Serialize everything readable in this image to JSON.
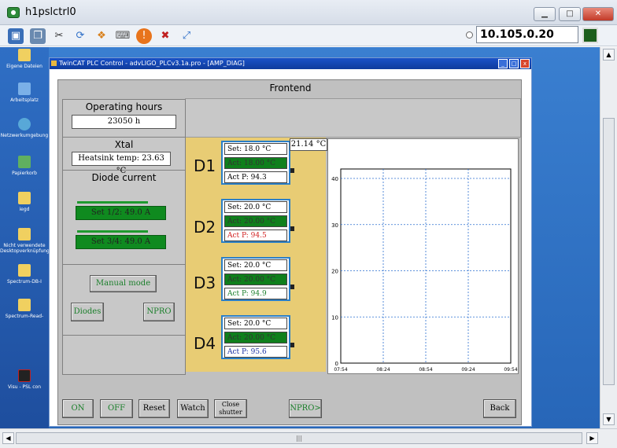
{
  "window": {
    "title": "h1pslctrl0",
    "address": "10.105.0.20"
  },
  "desktop": {
    "icons": [
      "Eigene Dateien",
      "Arbeitsplatz",
      "Netzwerkumgebung",
      "Papierkorb",
      "iegd",
      "Nicht verwendete Desktopverknüpfungen",
      "Spectrum-DB-I",
      "Spectrum-Read-",
      "Visu - PSL con"
    ]
  },
  "twincat": {
    "title": "TwinCAT PLC Control - advLIGO_PLCv3.1a.pro - [AMP_DIAG]"
  },
  "panel": {
    "heading": "Frontend",
    "operating_hours": {
      "label": "Operating hours",
      "value": "23050 h"
    },
    "xtal": {
      "label": "Xtal",
      "value": "Heatsink temp: 23.63 °C"
    },
    "diode_current": {
      "label": "Diode current",
      "set12": "Set 1/2: 49.0 A",
      "set34": "Set 3/4: 49.0 A"
    },
    "buttons": {
      "manual_mode": "Manual mode",
      "diodes": "Diodes",
      "npro": "NPRO"
    },
    "temp_reading": "21.14 °C",
    "diodes": [
      {
        "label": "D1",
        "set": "Set: 18.0 °C",
        "act": "Act: 18.00 °C",
        "power": "Act P: 94.3",
        "power_color": "#000000"
      },
      {
        "label": "D2",
        "set": "Set: 20.0 °C",
        "act": "Act: 20.00 °C",
        "power": "Act P: 94.5",
        "power_color": "#d02020"
      },
      {
        "label": "D3",
        "set": "Set: 20.0 °C",
        "act": "Act: 20.00 °C",
        "power": "Act P: 94.9",
        "power_color": "#1a7f2a"
      },
      {
        "label": "D4",
        "set": "Set: 20.0 °C",
        "act": "Act: 20.00 °C",
        "power": "Act P: 95.6",
        "power_color": "#1a2fa0"
      }
    ],
    "bottom": {
      "on": "ON",
      "off": "OFF",
      "reset": "Reset",
      "watch": "Watch",
      "close_shutter": "Close shutter",
      "npro_next": "NPRO>",
      "back": "Back"
    }
  },
  "chart_data": {
    "type": "line",
    "title": "",
    "xlabel": "",
    "ylabel": "",
    "x_ticks": [
      "07:54",
      "08:24",
      "08:54",
      "09:24",
      "09:54"
    ],
    "y_ticks": [
      0,
      10,
      20,
      30,
      40
    ],
    "ylim": [
      0,
      40
    ],
    "grid": true,
    "series": []
  }
}
